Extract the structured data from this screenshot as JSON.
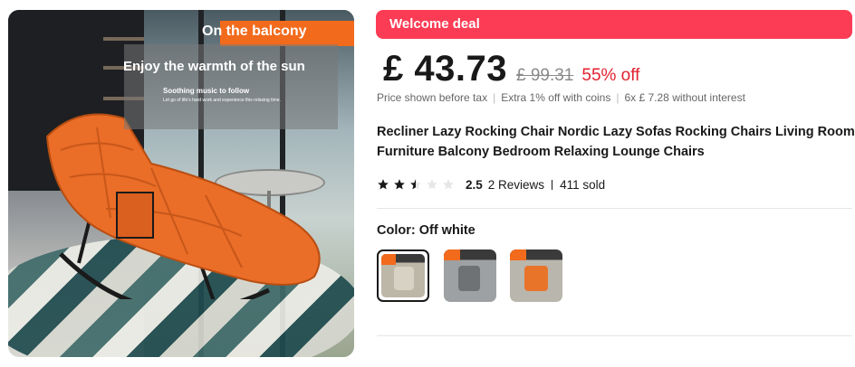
{
  "hero": {
    "banner_top": "On the balcony",
    "headline": "Enjoy the warmth of the sun",
    "subline": "Soothing music to follow",
    "small_text": "Let go of life's hard work and experience this relaxing time."
  },
  "deal": {
    "label": "Welcome deal"
  },
  "price": {
    "current": "£ 43.73",
    "original": "£ 99.31",
    "discount": "55% off"
  },
  "tax": {
    "note": "Price shown before tax",
    "coins": "Extra 1% off with coins",
    "installment": "6x  £ 7.28 without interest"
  },
  "product": {
    "title": "Recliner Lazy Rocking Chair Nordic Lazy Sofas Rocking Chairs Living Room Furniture Balcony Bedroom Relaxing Lounge Chairs"
  },
  "rating": {
    "value": 2.5,
    "value_text": "2.5",
    "reviews": "2 Reviews",
    "sold": "411 sold"
  },
  "color": {
    "label": "Color:",
    "selected": "Off white",
    "options": [
      {
        "name": "off-white",
        "tone": "#d8d2c4"
      },
      {
        "name": "gray",
        "tone": "#8e9092"
      },
      {
        "name": "orange",
        "tone": "#e8742a"
      }
    ]
  },
  "colors": {
    "deal_bg": "#fc3c55",
    "discount": "#e3222f",
    "accent_orange": "#f26a1b"
  }
}
